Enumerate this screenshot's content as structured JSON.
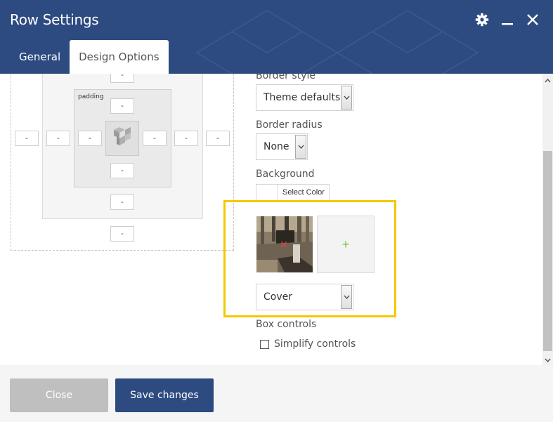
{
  "window": {
    "title": "Row Settings",
    "icons": [
      "gear-icon",
      "minimize-icon",
      "close-icon"
    ]
  },
  "tabs": [
    {
      "label": "General",
      "active": false
    },
    {
      "label": "Design Options",
      "active": true
    }
  ],
  "box_model": {
    "padding_label": "padding",
    "margin": {
      "top": "-",
      "right": "-",
      "bottom": "-",
      "left": "-"
    },
    "border": {
      "top": "-",
      "right": "-",
      "bottom": "-",
      "left": "-"
    },
    "padding": {
      "top": "-",
      "right": "-",
      "bottom": "-",
      "left": "-"
    }
  },
  "design": {
    "border_style_label": "Border style",
    "border_style_value": "Theme defaults",
    "border_radius_label": "Border radius",
    "border_radius_value": "None",
    "background_label": "Background",
    "select_color_label": "Select Color",
    "add_image_symbol": "+",
    "remove_image_symbol": "✕",
    "background_size_value": "Cover",
    "box_controls_label": "Box controls",
    "simplify_controls_label": "Simplify controls",
    "simplify_controls_checked": false
  },
  "footer": {
    "close_label": "Close",
    "save_label": "Save changes"
  },
  "colors": {
    "header": "#2d4b80",
    "highlight": "#f5c800",
    "add_icon": "#7ac143",
    "remove_icon": "#e04040"
  }
}
